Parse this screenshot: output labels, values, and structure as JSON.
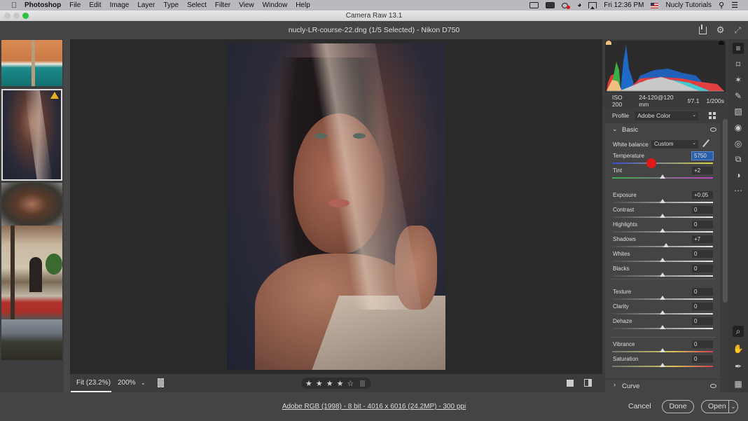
{
  "menubar": {
    "app_name": "Photoshop",
    "items": [
      "File",
      "Edit",
      "Image",
      "Layer",
      "Type",
      "Select",
      "Filter",
      "View",
      "Window",
      "Help"
    ],
    "clock": "Fri 12:36 PM",
    "user": "Nucly Tutorials",
    "status_icons": [
      "screen-record-icon",
      "battery-icon",
      "creative-cloud-icon",
      "wifi-icon",
      "airplay-icon",
      "flag-icon",
      "spotlight-search-icon",
      "notification-center-icon"
    ]
  },
  "window": {
    "title": "Camera Raw 13.1",
    "document": "nucly-LR-course-22.dng (1/5 Selected)  -  Nikon D750"
  },
  "filmstrip": {
    "thumbnails": [
      {
        "name": "beach-aerial",
        "selected": false,
        "warning": false
      },
      {
        "name": "veiled-portrait",
        "selected": true,
        "warning": true
      },
      {
        "name": "curly-hair-portrait",
        "selected": false,
        "warning": false
      },
      {
        "name": "building-facade",
        "selected": false,
        "warning": false
      },
      {
        "name": "landscape-dusk",
        "selected": false,
        "warning": false
      }
    ]
  },
  "bottom_toolbar": {
    "fit_label": "Fit (23.2%)",
    "zoom_label": "200%",
    "rating": 4,
    "rating_max": 5
  },
  "status": {
    "workflow_link": "Adobe RGB (1998) - 8 bit - 4016 x 6016 (24.2MP) - 300 ppi",
    "cancel": "Cancel",
    "done": "Done",
    "open": "Open"
  },
  "right_panel": {
    "exif": {
      "iso": "ISO 200",
      "lens": "24-120@120 mm",
      "aperture": "f/7.1",
      "shutter": "1/200s"
    },
    "profile_label": "Profile",
    "profile_value": "Adobe Color",
    "basic": {
      "title": "Basic",
      "white_balance_label": "White balance",
      "white_balance_value": "Custom",
      "sliders": [
        {
          "label": "Temperature",
          "value": "5750",
          "position": 0.39,
          "group": "wb",
          "track": "temp",
          "selected": true
        },
        {
          "label": "Tint",
          "value": "+2",
          "position": 0.5,
          "group": "wb",
          "track": "tint"
        },
        {
          "label": "Exposure",
          "value": "+0.05",
          "position": 0.5,
          "group": "tone",
          "track": "gray"
        },
        {
          "label": "Contrast",
          "value": "0",
          "position": 0.5,
          "group": "tone",
          "track": "gray"
        },
        {
          "label": "Highlights",
          "value": "0",
          "position": 0.5,
          "group": "tone",
          "track": "gray"
        },
        {
          "label": "Shadows",
          "value": "+7",
          "position": 0.535,
          "group": "tone",
          "track": "gray"
        },
        {
          "label": "Whites",
          "value": "0",
          "position": 0.5,
          "group": "tone",
          "track": "gray"
        },
        {
          "label": "Blacks",
          "value": "0",
          "position": 0.5,
          "group": "tone",
          "track": "gray"
        },
        {
          "label": "Texture",
          "value": "0",
          "position": 0.5,
          "group": "presence",
          "track": "gray"
        },
        {
          "label": "Clarity",
          "value": "0",
          "position": 0.5,
          "group": "presence",
          "track": "gray"
        },
        {
          "label": "Dehaze",
          "value": "0",
          "position": 0.5,
          "group": "presence",
          "track": "gray"
        },
        {
          "label": "Vibrance",
          "value": "0",
          "position": 0.5,
          "group": "color",
          "track": "sat"
        },
        {
          "label": "Saturation",
          "value": "0",
          "position": 0.5,
          "group": "color",
          "track": "sat"
        }
      ]
    },
    "curve_title": "Curve"
  },
  "tools": {
    "top": [
      "edit-sliders-icon",
      "crop-icon",
      "healing-icon",
      "brush-icon",
      "gradient-icon",
      "radial-filter-icon",
      "red-eye-icon",
      "snapshots-icon",
      "presets-icon",
      "more-icon"
    ],
    "bottom": [
      "zoom-icon",
      "hand-icon",
      "color-sampler-icon",
      "grid-icon"
    ]
  }
}
